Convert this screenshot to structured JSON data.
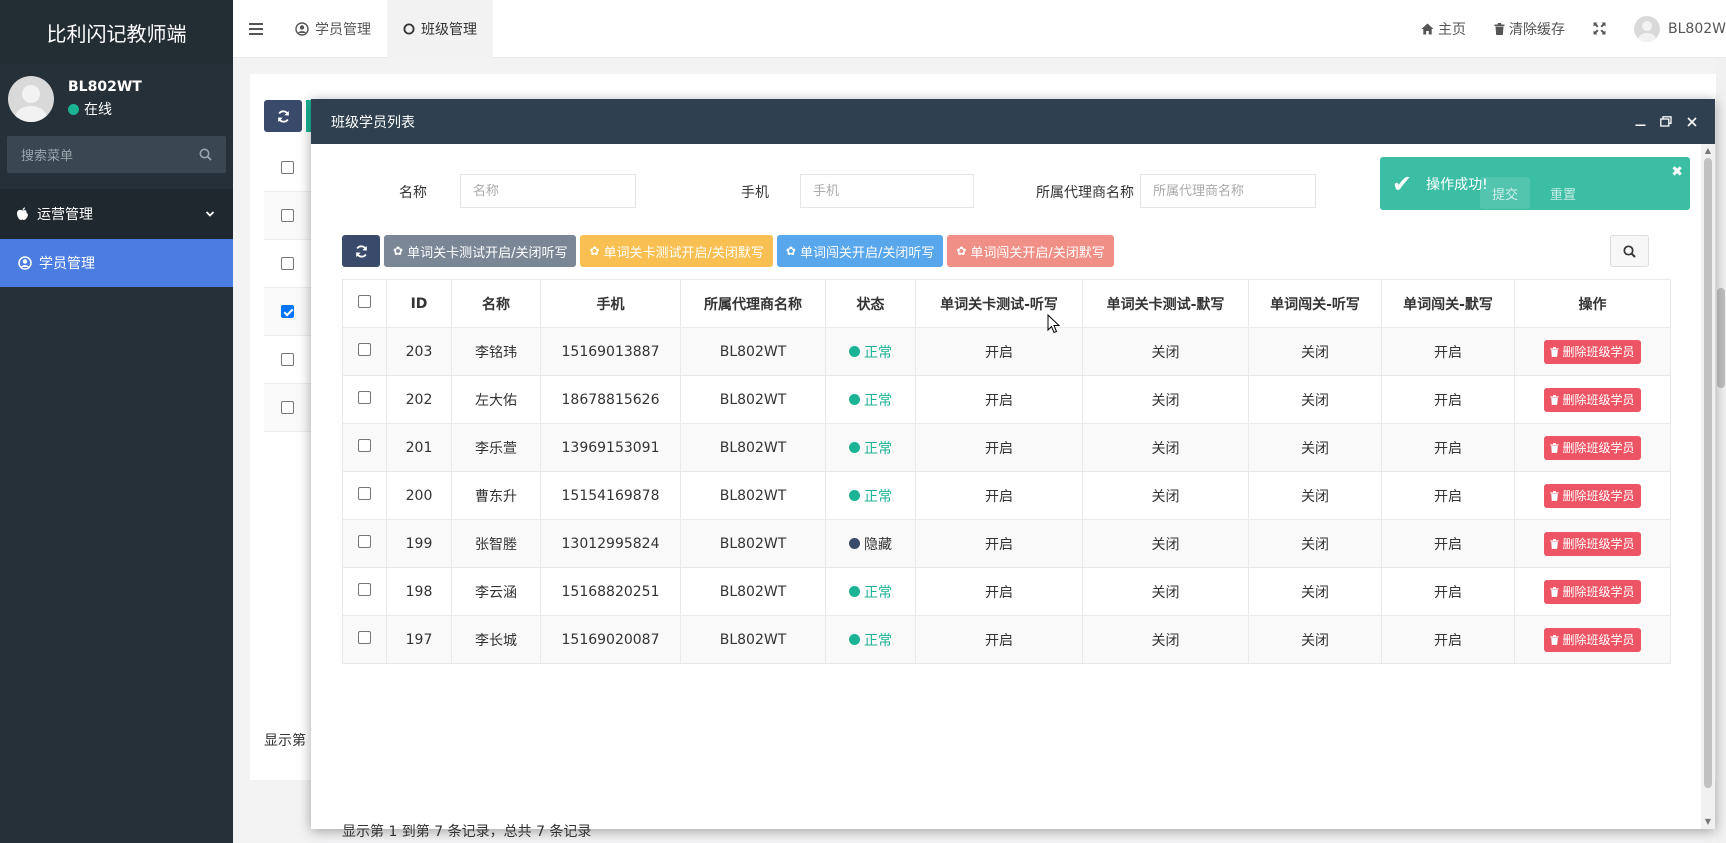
{
  "app": {
    "title": "比利闪记教师端"
  },
  "sidebar": {
    "user_name": "BL802WT",
    "user_status": "在线",
    "search_placeholder": "搜索菜单",
    "group_label": "运营管理",
    "active_item": "学员管理"
  },
  "navbar": {
    "tabs": [
      "学员管理",
      "班级管理"
    ],
    "home": "主页",
    "clear_cache": "清除缓存",
    "user": "BL802W"
  },
  "background_page": {
    "footer": "显示第"
  },
  "modal": {
    "title": "班级学员列表",
    "search": {
      "name_label": "名称",
      "name_placeholder": "名称",
      "phone_label": "手机",
      "phone_placeholder": "手机",
      "agent_label": "所属代理商名称",
      "agent_placeholder": "所属代理商名称",
      "submit": "提交",
      "reset": "重置"
    },
    "toolbar": {
      "btn1": "单词关卡测试开启/关闭听写",
      "btn2": "单词关卡测试开启/关闭默写",
      "btn3": "单词闯关开启/关闭听写",
      "btn4": "单词闯关开启/关闭默写"
    },
    "table": {
      "headers": [
        "ID",
        "名称",
        "手机",
        "所属代理商名称",
        "状态",
        "单词关卡测试-听写",
        "单词关卡测试-默写",
        "单词闯关-听写",
        "单词闯关-默写",
        "操作"
      ],
      "delete_label": "删除班级学员",
      "rows": [
        {
          "id": "203",
          "name": "李铭玮",
          "phone": "15169013887",
          "agent": "BL802WT",
          "status": "正常",
          "test_listen": "开启",
          "test_write": "关闭",
          "pass_listen": "关闭",
          "pass_write": "开启"
        },
        {
          "id": "202",
          "name": "左大佑",
          "phone": "18678815626",
          "agent": "BL802WT",
          "status": "正常",
          "test_listen": "开启",
          "test_write": "关闭",
          "pass_listen": "关闭",
          "pass_write": "开启"
        },
        {
          "id": "201",
          "name": "李乐萱",
          "phone": "13969153091",
          "agent": "BL802WT",
          "status": "正常",
          "test_listen": "开启",
          "test_write": "关闭",
          "pass_listen": "关闭",
          "pass_write": "开启"
        },
        {
          "id": "200",
          "name": "曹东升",
          "phone": "15154169878",
          "agent": "BL802WT",
          "status": "正常",
          "test_listen": "开启",
          "test_write": "关闭",
          "pass_listen": "关闭",
          "pass_write": "开启"
        },
        {
          "id": "199",
          "name": "张智塍",
          "phone": "13012995824",
          "agent": "BL802WT",
          "status": "隐藏",
          "test_listen": "开启",
          "test_write": "关闭",
          "pass_listen": "关闭",
          "pass_write": "开启"
        },
        {
          "id": "198",
          "name": "李云涵",
          "phone": "15168820251",
          "agent": "BL802WT",
          "status": "正常",
          "test_listen": "开启",
          "test_write": "关闭",
          "pass_listen": "关闭",
          "pass_write": "开启"
        },
        {
          "id": "197",
          "name": "李长城",
          "phone": "15169020087",
          "agent": "BL802WT",
          "status": "正常",
          "test_listen": "开启",
          "test_write": "关闭",
          "pass_listen": "关闭",
          "pass_write": "开启"
        }
      ]
    },
    "footer": "显示第 1 到第 7 条记录，总共 7 条记录"
  },
  "toast": {
    "message": "操作成功!"
  },
  "colors": {
    "status_normal": "#1ab394",
    "status_hidden": "#3a4a6b",
    "on_text": "#1ab394",
    "delete_button": "#ed5565"
  }
}
